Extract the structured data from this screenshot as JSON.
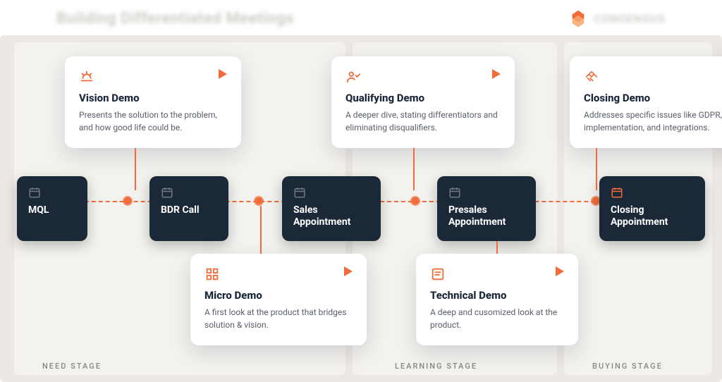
{
  "header": {
    "title": "Building Differentiated Meetings",
    "brand": "CONSENSUS"
  },
  "phases": {
    "need": "NEED STAGE",
    "learning": "LEARNING STAGE",
    "buying": "BUYING STAGE"
  },
  "stages": {
    "mql": "MQL",
    "bdr": "BDR Call",
    "sales": "Sales Appointment",
    "presales": "Presales Appointment",
    "closing": "Closing Appointment"
  },
  "demos": {
    "vision": {
      "title": "Vision Demo",
      "desc": "Presents the solution to the problem, and how good life could be."
    },
    "qualifying": {
      "title": "Qualifying Demo",
      "desc": "A deeper dive, stating differentiators and eliminating disqualifiers."
    },
    "closing": {
      "title": "Closing Demo",
      "desc": "Addresses specific issues like GDPR, implementation, and integrations."
    },
    "micro": {
      "title": "Micro Demo",
      "desc": "A first look at the product that bridges solution & vision."
    },
    "technical": {
      "title": "Technical Demo",
      "desc": "A deep and cusomized look at the product."
    }
  }
}
